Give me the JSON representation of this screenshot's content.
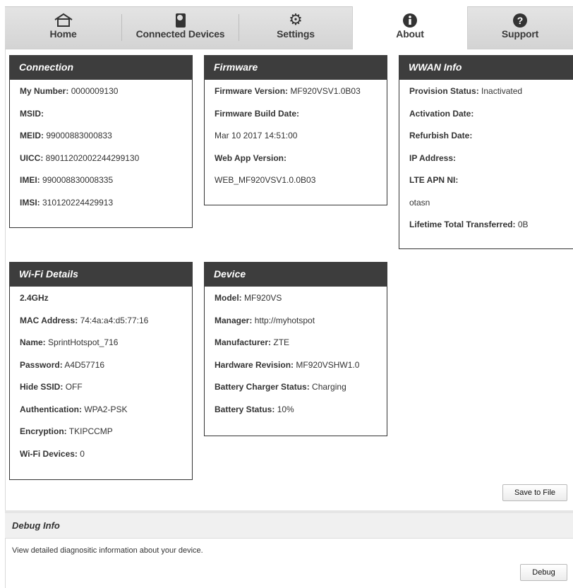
{
  "tabs": [
    {
      "label": "Home",
      "icon": "home-icon",
      "active": false
    },
    {
      "label": "Connected Devices",
      "icon": "device-icon",
      "active": false
    },
    {
      "label": "Settings",
      "icon": "gear-icon",
      "active": false
    },
    {
      "label": "About",
      "icon": "info-icon",
      "active": true
    },
    {
      "label": "Support",
      "icon": "help-icon",
      "active": false
    }
  ],
  "connection": {
    "title": "Connection",
    "rows": [
      {
        "k": "My Number:",
        "v": "0000009130"
      },
      {
        "k": "MSID:",
        "v": ""
      },
      {
        "k": "MEID:",
        "v": "99000883000833"
      },
      {
        "k": "UICC:",
        "v": "89011202002244299130"
      },
      {
        "k": "IMEI:",
        "v": "990008830008335"
      },
      {
        "k": "IMSI:",
        "v": "310120224429913"
      }
    ]
  },
  "firmware": {
    "title": "Firmware",
    "rows": [
      {
        "k": "Firmware Version:",
        "v": "MF920VSV1.0B03"
      },
      {
        "k": "Firmware Build Date:",
        "v": ""
      },
      {
        "k": "",
        "v": "Mar 10 2017 14:51:00"
      },
      {
        "k": "Web App Version:",
        "v": ""
      },
      {
        "k": "",
        "v": "WEB_MF920VSV1.0.0B03"
      }
    ]
  },
  "wwan": {
    "title": "WWAN Info",
    "rows": [
      {
        "k": "Provision Status:",
        "v": "Inactivated"
      },
      {
        "k": "Activation Date:",
        "v": ""
      },
      {
        "k": "Refurbish Date:",
        "v": ""
      },
      {
        "k": "IP Address:",
        "v": ""
      },
      {
        "k": "LTE APN NI:",
        "v": ""
      },
      {
        "k": "",
        "v": "otasn"
      },
      {
        "k": "Lifetime Total Transferred:",
        "v": "0B"
      }
    ]
  },
  "wifi": {
    "title": "Wi-Fi Details",
    "rows": [
      {
        "k": "2.4GHz",
        "v": ""
      },
      {
        "k": "MAC Address:",
        "v": "74:4a:a4:d5:77:16"
      },
      {
        "k": "Name:",
        "v": "SprintHotspot_716"
      },
      {
        "k": "Password:",
        "v": "A4D57716"
      },
      {
        "k": "Hide SSID:",
        "v": "OFF"
      },
      {
        "k": "Authentication:",
        "v": "WPA2-PSK"
      },
      {
        "k": "Encryption:",
        "v": "TKIPCCMP"
      },
      {
        "k": "Wi-Fi Devices:",
        "v": "0"
      }
    ]
  },
  "device": {
    "title": "Device",
    "rows": [
      {
        "k": "Model:",
        "v": "MF920VS"
      },
      {
        "k": "Manager:",
        "v": "http://myhotspot"
      },
      {
        "k": "Manufacturer:",
        "v": "ZTE"
      },
      {
        "k": "Hardware Revision:",
        "v": "MF920VSHW1.0"
      },
      {
        "k": "Battery Charger Status:",
        "v": "Charging"
      },
      {
        "k": "Battery Status:",
        "v": "10%"
      }
    ]
  },
  "actions": {
    "save_label": "Save to File"
  },
  "debug": {
    "title": "Debug Info",
    "description": "View detailed diagnositic information about your device.",
    "button_label": "Debug"
  },
  "colors": {
    "panel_header": "#3d3d3d",
    "tab_bg": "#dcdcdc",
    "active_tab_bg": "#ffffff"
  }
}
